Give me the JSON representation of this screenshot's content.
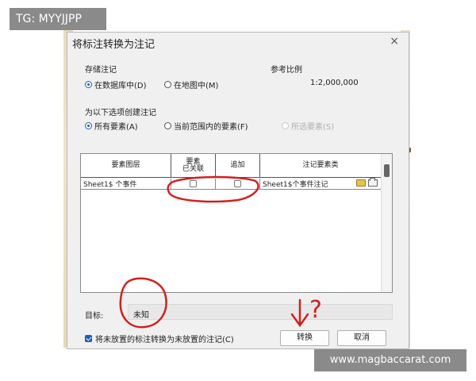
{
  "watermarks": {
    "top_left": "TG: MYYJJPP",
    "bottom_right": "www.magbaccarat.com"
  },
  "dialog": {
    "title": "将标注转换为注记",
    "close_glyph": "×",
    "storage": {
      "label": "存储注记",
      "options": [
        "在数据库中(D)",
        "在地图中(M)"
      ],
      "selected": 0
    },
    "reference_scale": {
      "label": "参考比例",
      "value": "1:2,000,000"
    },
    "create_for": {
      "label": "为以下选项创建注记",
      "options": [
        "所有要素(A)",
        "当前范围内的要素(F)",
        "所选要素(S)"
      ],
      "selected": 0,
      "disabled": [
        2
      ]
    },
    "table": {
      "headers": [
        "要素图层",
        "要素\n已关联",
        "追加",
        "注记要素类"
      ],
      "rows": [
        {
          "layer": "Sheet1$ 个事件",
          "linked": false,
          "append": false,
          "annotation_class": "Sheet1$个事件注记",
          "icons": [
            "open-icon",
            "folder-icon"
          ]
        }
      ]
    },
    "target": {
      "label": "目标:",
      "value": "未知"
    },
    "unplaced_checkbox": {
      "label": "将未放置的标注转换为未放置的注记(C)",
      "checked": true
    },
    "buttons": {
      "convert": "转换",
      "cancel": "取消"
    },
    "annotations": {
      "color": "#d42020",
      "question_mark": "?"
    }
  }
}
